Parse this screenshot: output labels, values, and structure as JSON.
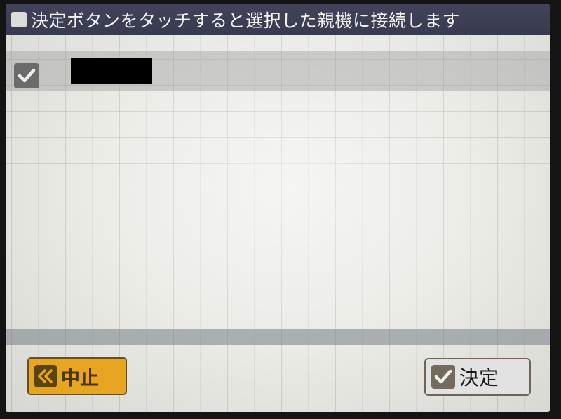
{
  "header": {
    "title": "決定ボタンをタッチすると選択した親機に接続します",
    "icon": "square-icon"
  },
  "list": {
    "items": [
      {
        "checked": true,
        "check_icon": "checkmark-icon",
        "name": ""
      }
    ]
  },
  "footer": {
    "cancel_label": "中止",
    "cancel_icon": "double-chevron-left-icon",
    "ok_label": "決定",
    "ok_icon": "checkmark-icon"
  },
  "colors": {
    "header_bg": "#3d3f55",
    "screen_bg": "#e9e9e4",
    "cancel_button": "#e8a522",
    "ok_button": "#e2e2e2"
  }
}
